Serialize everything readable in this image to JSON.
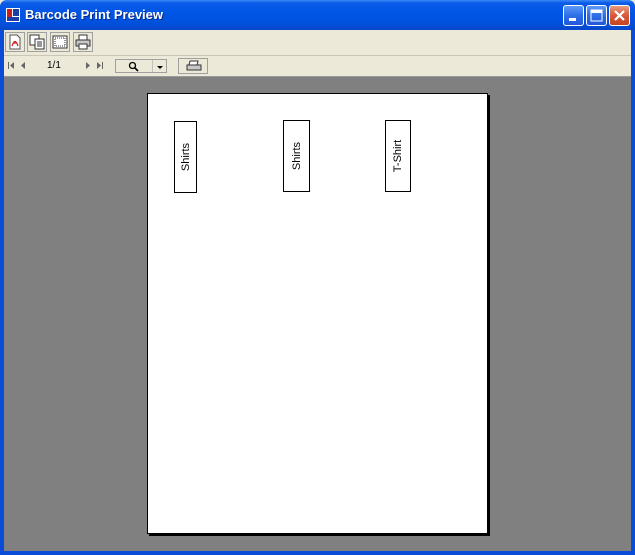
{
  "window": {
    "title": "Barcode Print Preview"
  },
  "toolbar": {
    "buttons": [
      {
        "name": "export-pdf",
        "icon": "pdf-icon"
      },
      {
        "name": "copy",
        "icon": "copy-icon"
      },
      {
        "name": "page-setup",
        "icon": "page-setup-icon"
      },
      {
        "name": "print",
        "icon": "printer-icon"
      }
    ]
  },
  "navigation": {
    "page_indicator": "1/1"
  },
  "labels": [
    {
      "text": "Shirts"
    },
    {
      "text": "Shirts"
    },
    {
      "text": "T-Shirt"
    }
  ],
  "colors": {
    "title_bar": "#0055E5",
    "preview_background": "#808080",
    "window_face": "#ECE9D8"
  }
}
